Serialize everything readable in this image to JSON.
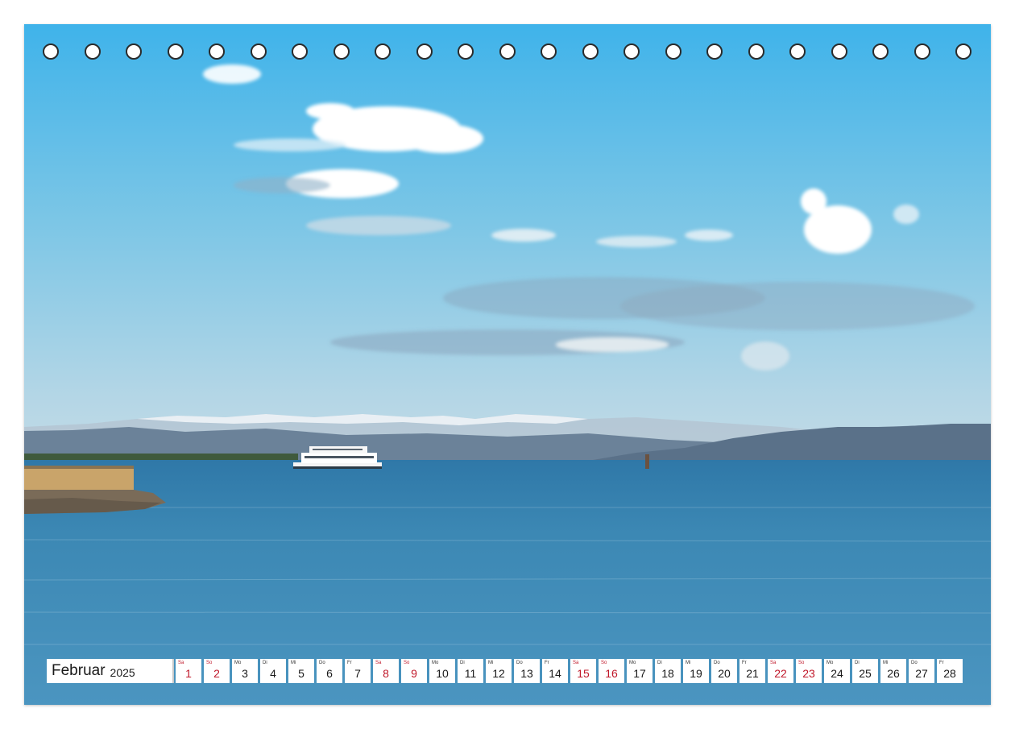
{
  "calendar": {
    "month": "Februar",
    "year": "2025",
    "weekend_color": "#c0182a",
    "days": [
      {
        "wd": "Sa",
        "num": "1",
        "weekend": true
      },
      {
        "wd": "So",
        "num": "2",
        "weekend": true
      },
      {
        "wd": "Mo",
        "num": "3",
        "weekend": false
      },
      {
        "wd": "Di",
        "num": "4",
        "weekend": false
      },
      {
        "wd": "Mi",
        "num": "5",
        "weekend": false
      },
      {
        "wd": "Do",
        "num": "6",
        "weekend": false
      },
      {
        "wd": "Fr",
        "num": "7",
        "weekend": false
      },
      {
        "wd": "Sa",
        "num": "8",
        "weekend": true
      },
      {
        "wd": "So",
        "num": "9",
        "weekend": true
      },
      {
        "wd": "Mo",
        "num": "10",
        "weekend": false
      },
      {
        "wd": "Di",
        "num": "11",
        "weekend": false
      },
      {
        "wd": "Mi",
        "num": "12",
        "weekend": false
      },
      {
        "wd": "Do",
        "num": "13",
        "weekend": false
      },
      {
        "wd": "Fr",
        "num": "14",
        "weekend": false
      },
      {
        "wd": "Sa",
        "num": "15",
        "weekend": true
      },
      {
        "wd": "So",
        "num": "16",
        "weekend": true
      },
      {
        "wd": "Mo",
        "num": "17",
        "weekend": false
      },
      {
        "wd": "Di",
        "num": "18",
        "weekend": false
      },
      {
        "wd": "Mi",
        "num": "19",
        "weekend": false
      },
      {
        "wd": "Do",
        "num": "20",
        "weekend": false
      },
      {
        "wd": "Fr",
        "num": "21",
        "weekend": false
      },
      {
        "wd": "Sa",
        "num": "22",
        "weekend": true
      },
      {
        "wd": "So",
        "num": "23",
        "weekend": true
      },
      {
        "wd": "Mo",
        "num": "24",
        "weekend": false
      },
      {
        "wd": "Di",
        "num": "25",
        "weekend": false
      },
      {
        "wd": "Mi",
        "num": "26",
        "weekend": false
      },
      {
        "wd": "Do",
        "num": "27",
        "weekend": false
      },
      {
        "wd": "Fr",
        "num": "28",
        "weekend": false
      }
    ]
  },
  "photo": {
    "scene": "lake-with-ferry-and-alps",
    "sky_color": "#4fb8e8",
    "water_color": "#3a86b0"
  },
  "binding": {
    "hole_count": 23
  }
}
